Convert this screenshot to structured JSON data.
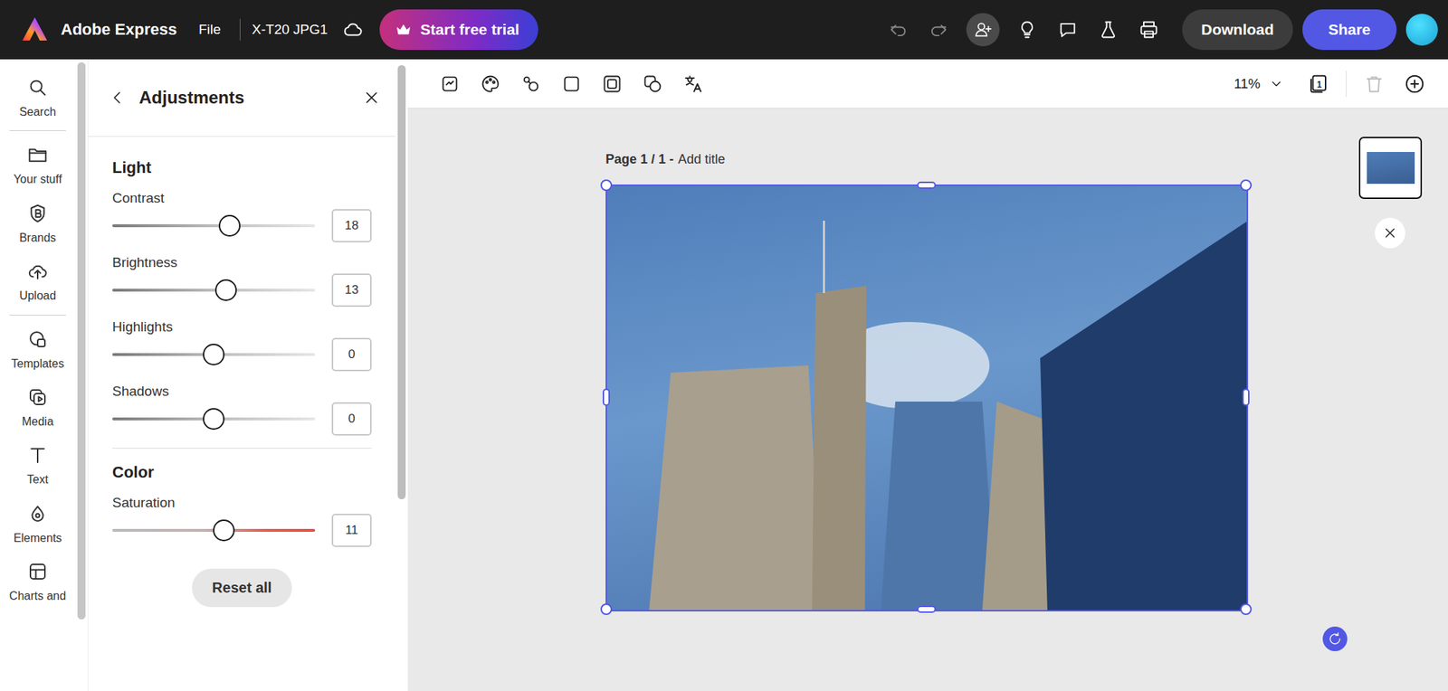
{
  "app": {
    "name": "Adobe Express",
    "file_menu": "File",
    "document_title": "X-T20 JPG1",
    "trial_button": "Start free trial",
    "download_button": "Download",
    "share_button": "Share"
  },
  "rail": [
    {
      "label": "Search"
    },
    {
      "label": "Your stuff"
    },
    {
      "label": "Brands"
    },
    {
      "label": "Upload"
    },
    {
      "label": "Templates"
    },
    {
      "label": "Media"
    },
    {
      "label": "Text"
    },
    {
      "label": "Elements"
    },
    {
      "label": "Charts and"
    }
  ],
  "panel": {
    "title": "Adjustments",
    "sections": [
      {
        "heading": "Light",
        "sliders": [
          {
            "label": "Contrast",
            "value": "18",
            "level": 0.58,
            "kind": "neutral"
          },
          {
            "label": "Brightness",
            "value": "13",
            "level": 0.56,
            "kind": "neutral"
          },
          {
            "label": "Highlights",
            "value": "0",
            "level": 0.5,
            "kind": "neutral"
          },
          {
            "label": "Shadows",
            "value": "0",
            "level": 0.5,
            "kind": "neutral"
          }
        ]
      },
      {
        "heading": "Color",
        "sliders": [
          {
            "label": "Saturation",
            "value": "11",
            "level": 0.55,
            "kind": "saturation"
          }
        ]
      }
    ],
    "reset_button": "Reset all"
  },
  "canvas": {
    "zoom": "11%",
    "page_count": "1",
    "delete_disabled": true,
    "page_label": "Page 1 / 1 -",
    "page_title_placeholder": "Add title",
    "thumbnails": [
      {
        "selected": true
      }
    ]
  }
}
